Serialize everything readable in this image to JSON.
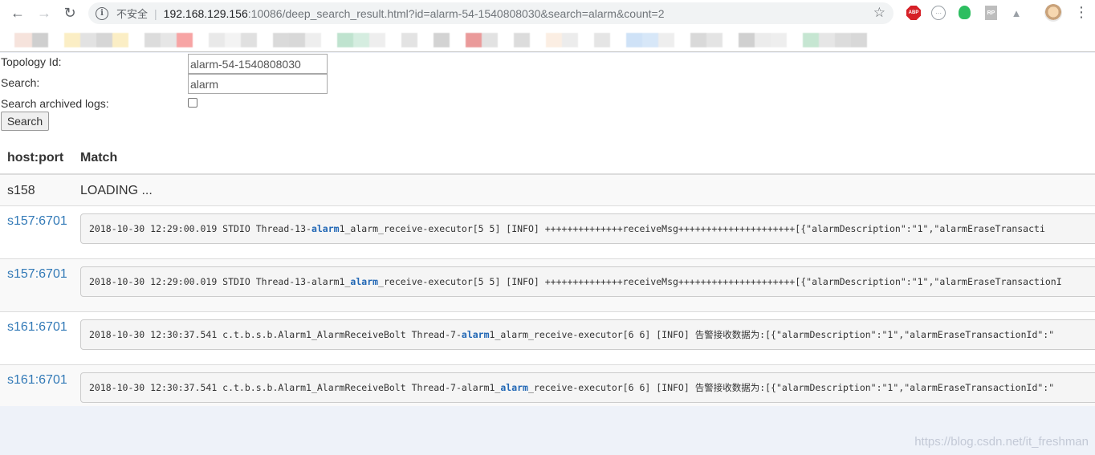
{
  "browser": {
    "security_label": "不安全",
    "url_host": "192.168.129.156",
    "url_rest": ":10086/deep_search_result.html?id=alarm-54-1540808030&search=alarm&count=2",
    "info_icon": "i",
    "abp_label": "ABP",
    "rp_label": "RP"
  },
  "form": {
    "topology_label": "Topology Id:",
    "topology_value": "alarm-54-1540808030",
    "search_label": "Search:",
    "search_value": "alarm",
    "archived_label": "Search archived logs:",
    "archived_checked": false,
    "search_button": "Search"
  },
  "table": {
    "headers": [
      "host:port",
      "Match"
    ],
    "loading_host": "s158",
    "loading_text": "LOADING ...",
    "rows": [
      {
        "host": "s157:6701",
        "pre": "2018-10-30 12:29:00.019 STDIO Thread-13-",
        "hl": "alarm",
        "post": "1_alarm_receive-executor[5 5] [INFO] ++++++++++++++receiveMsg+++++++++++++++++++++[{\"alarmDescription\":\"1\",\"alarmEraseTransacti"
      },
      {
        "host": "s157:6701",
        "pre": "2018-10-30 12:29:00.019 STDIO Thread-13-alarm1_",
        "hl": "alarm",
        "post": "_receive-executor[5 5] [INFO] ++++++++++++++receiveMsg+++++++++++++++++++++[{\"alarmDescription\":\"1\",\"alarmEraseTransactionI"
      },
      {
        "host": "s161:6701",
        "pre": "2018-10-30 12:30:37.541 c.t.b.s.b.Alarm1_AlarmReceiveBolt Thread-7-",
        "hl": "alarm",
        "post": "1_alarm_receive-executor[6 6] [INFO] 告警接收数据为:[{\"alarmDescription\":\"1\",\"alarmEraseTransactionId\":\""
      },
      {
        "host": "s161:6701",
        "pre": "2018-10-30 12:30:37.541 c.t.b.s.b.Alarm1_AlarmReceiveBolt Thread-7-alarm1_",
        "hl": "alarm",
        "post": "_receive-executor[6 6] [INFO] 告警接收数据为:[{\"alarmDescription\":\"1\",\"alarmEraseTransactionId\":\""
      }
    ]
  },
  "watermark": "https://blog.csdn.net/it_freshman",
  "colors": {
    "link": "#337ab7",
    "highlight": "#2167b5",
    "abp": "#d62027",
    "evernote": "#2dbe60"
  }
}
